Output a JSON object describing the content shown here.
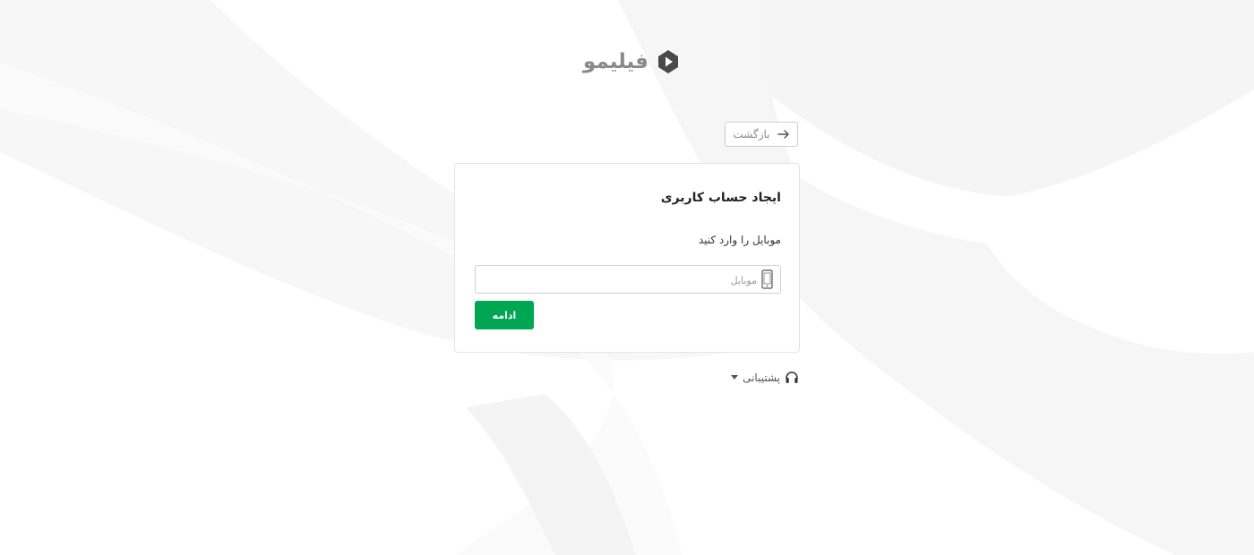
{
  "brand": {
    "name": "فیلیمو",
    "logo_color": "#4a4a4a",
    "text_color": "#8a8a8a"
  },
  "navigation": {
    "back_label": "بازگشت",
    "back_icon": "arrow-right-icon"
  },
  "signup": {
    "title": "ایجاد حساب کاربری",
    "instruction": "موبایل را وارد کنید",
    "mobile_input": {
      "value": "",
      "placeholder": "موبایل",
      "icon": "mobile-phone-icon"
    },
    "continue_label": "ادامه",
    "continue_color": "#00a651"
  },
  "support": {
    "label": "پشتیبانی",
    "icon": "headset-icon",
    "dropdown_icon": "caret-down-icon"
  }
}
